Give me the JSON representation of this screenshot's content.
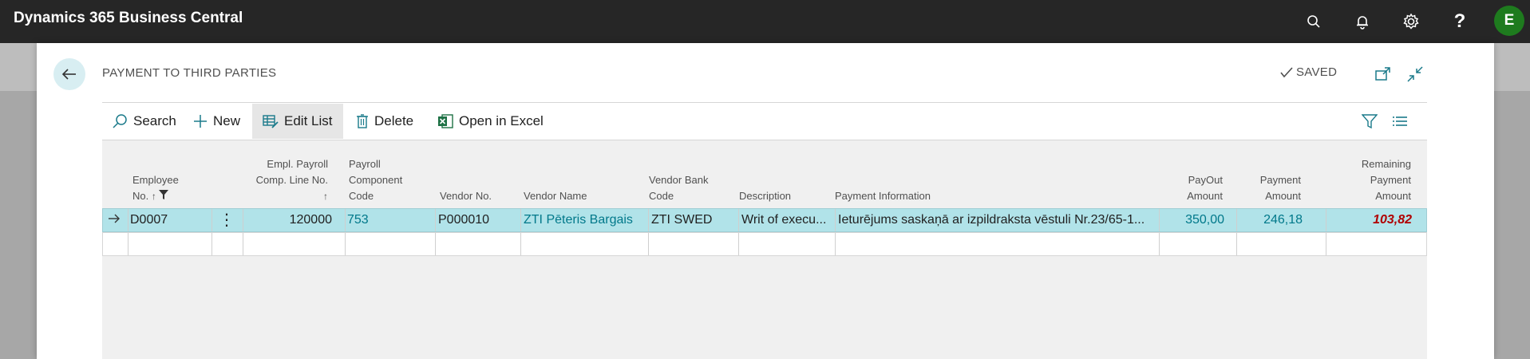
{
  "app": {
    "title": "Dynamics 365 Business Central",
    "user_initial": "E"
  },
  "page": {
    "title": "PAYMENT TO THIRD PARTIES",
    "status": "SAVED"
  },
  "actions": {
    "search": "Search",
    "new": "New",
    "edit_list": "Edit List",
    "delete": "Delete",
    "open_in_excel": "Open in Excel"
  },
  "columns": [
    {
      "key": "employee_no",
      "lines": [
        "Employee",
        "No."
      ]
    },
    {
      "key": "empl_payroll_comp_line_no",
      "lines": [
        "Empl. Payroll",
        "Comp. Line No."
      ]
    },
    {
      "key": "payroll_component_code",
      "lines": [
        "Payroll",
        "Component",
        "Code"
      ]
    },
    {
      "key": "vendor_no",
      "lines": [
        "Vendor No."
      ]
    },
    {
      "key": "vendor_name",
      "lines": [
        "Vendor Name"
      ]
    },
    {
      "key": "vendor_bank_code",
      "lines": [
        "Vendor Bank",
        "Code"
      ]
    },
    {
      "key": "description",
      "lines": [
        "Description"
      ]
    },
    {
      "key": "payment_information",
      "lines": [
        "Payment Information"
      ]
    },
    {
      "key": "payout_amount",
      "lines": [
        "PayOut",
        "Amount"
      ]
    },
    {
      "key": "payment_amount",
      "lines": [
        "Payment",
        "Amount"
      ]
    },
    {
      "key": "remaining_payment_amount",
      "lines": [
        "Remaining",
        "Payment",
        "Amount"
      ]
    }
  ],
  "rows": [
    {
      "employee_no": "D0007",
      "empl_payroll_comp_line_no": "120000",
      "payroll_component_code": "753",
      "vendor_no": "P000010",
      "vendor_name": "ZTI Pēteris Bargais",
      "vendor_bank_code": "ZTI SWED",
      "description": "Writ of execu...",
      "payment_information": "Ieturējums saskaņā ar izpildraksta vēstuli Nr.23/65-1...",
      "payout_amount": "350,00",
      "payment_amount": "246,18",
      "remaining_payment_amount": "103,82"
    }
  ],
  "colors": {
    "topbar": "#262626",
    "accent": "#00788a",
    "selected_row": "#b1e3e9",
    "negative_value": "#b00000",
    "avatar": "#1e7b1e"
  }
}
